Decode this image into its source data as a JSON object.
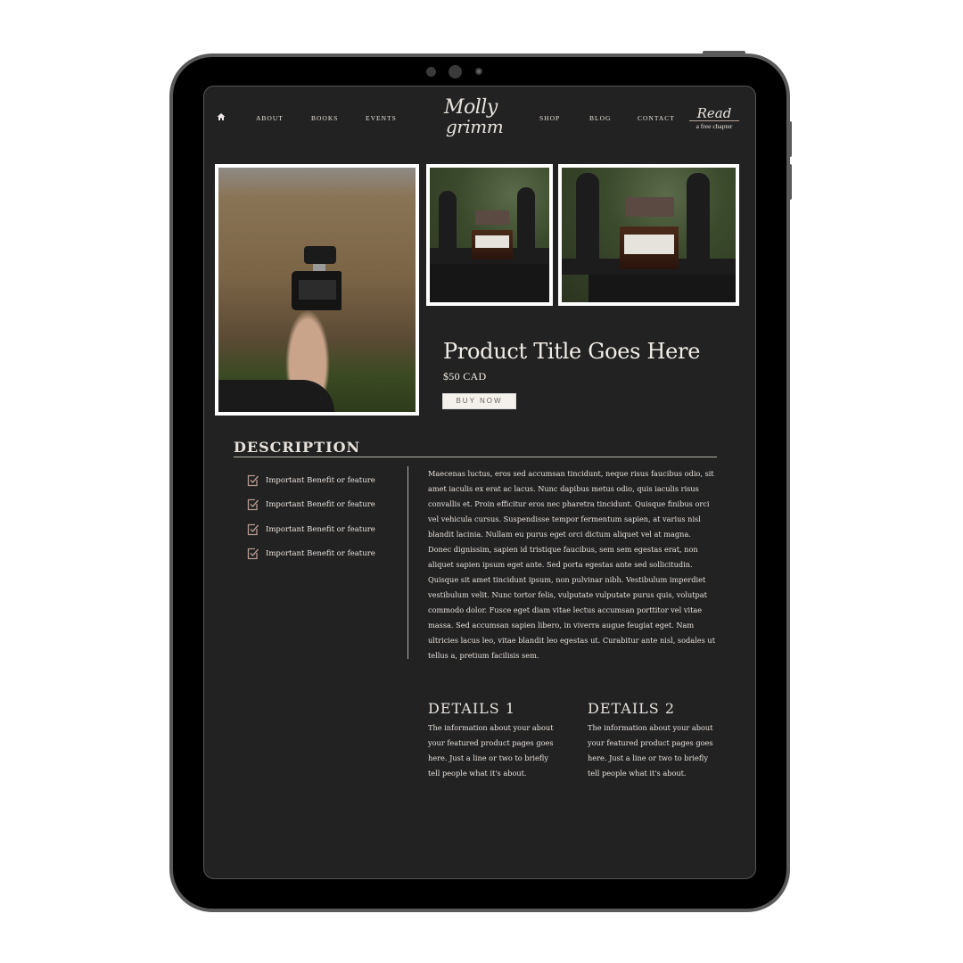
{
  "colors": {
    "screen_bg": "#222222",
    "text": "#e8e2dc",
    "accent_checkbox": "#b39a8f",
    "button_bg": "#f4f0eb",
    "bezel": "#000000",
    "frame": "#5a5a5a"
  },
  "nav": {
    "home_icon": "home-icon",
    "left_items": [
      {
        "label": "ABOUT"
      },
      {
        "label": "BOOKS"
      },
      {
        "label": "EVENTS"
      }
    ],
    "logo": {
      "line1": "Molly",
      "line2": "grimm"
    },
    "right_items": [
      {
        "label": "SHOP"
      },
      {
        "label": "BLOG"
      },
      {
        "label": "CONTACT"
      }
    ],
    "cta": {
      "line1": "Read",
      "line2": "a free chapter"
    }
  },
  "gallery": {
    "images": [
      {
        "alt": "Hand holding black perfume bottle in front of old stone building"
      },
      {
        "alt": "Amber perfume bottle on iron fence"
      },
      {
        "alt": "Amber perfume bottle on iron fence close-up"
      }
    ]
  },
  "product": {
    "title": "Product Title Goes Here",
    "price": "$50 CAD",
    "buy_label": "BUY NOW"
  },
  "description": {
    "heading": "DESCRIPTION",
    "benefits": [
      "Important Benefit or feature",
      "Important Benefit or feature",
      "Important Benefit or feature",
      "Important Benefit or feature"
    ],
    "body": "Maecenas luctus, eros sed accumsan tincidunt, neque risus faucibus odio, sit amet iaculis ex erat ac lacus. Nunc dapibus metus odio, quis iaculis risus convallis et. Proin efficitur eros nec pharetra tincidunt. Quisque finibus orci vel vehicula cursus. Suspendisse tempor fermentum sapien, at varius nisl blandit lacinia. Nullam eu purus eget orci dictum aliquet vel at magna. Donec dignissim, sapien id tristique faucibus, sem sem egestas erat, non aliquet sapien ipsum eget ante. Sed porta egestas ante sed sollicitudin. Quisque sit amet tincidunt ipsum, non pulvinar nibh. Vestibulum imperdiet vestibulum velit. Nunc tortor felis, vulputate vulputate purus quis, volutpat commodo dolor. Fusce eget diam vitae lectus accumsan porttitor vel vitae massa. Sed accumsan sapien libero, in viverra augue feugiat eget. Nam ultricies lacus leo, vitae blandit leo egestas ut. Curabitur ante nisl, sodales ut tellus a, pretium facilisis sem."
  },
  "details": [
    {
      "heading": "DETAILS 1",
      "text": "The information about your about your featured product pages goes here. Just a line or two to briefly tell people what it's about."
    },
    {
      "heading": "DETAILS 2",
      "text": "The information about your about your featured product pages goes here. Just a line or two to briefly tell people what it's about."
    }
  ]
}
